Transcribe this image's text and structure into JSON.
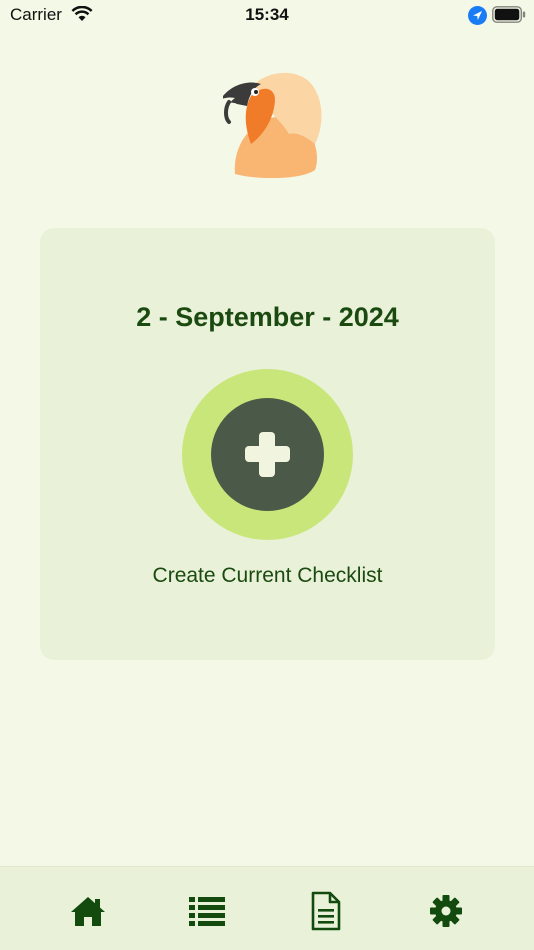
{
  "status_bar": {
    "carrier": "Carrier",
    "time": "15:34"
  },
  "card": {
    "date": "2 - September - 2024",
    "create_label": "Create Current Checklist"
  },
  "icons": {
    "logo": "vulture-logo-icon",
    "add": "plus-icon",
    "tabs": [
      "home-icon",
      "list-icon",
      "document-icon",
      "gear-icon"
    ]
  },
  "colors": {
    "background": "#f4f8e6",
    "card": "#e9f2d9",
    "accent_light": "#c9e67a",
    "accent_dark": "#4b5a48",
    "text": "#1b4a10"
  }
}
